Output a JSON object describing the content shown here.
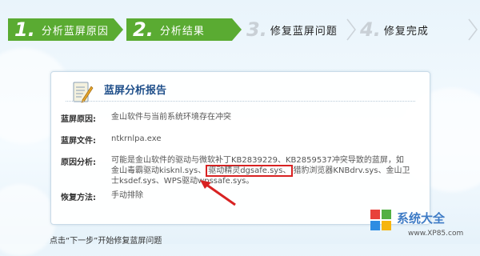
{
  "steps": [
    {
      "num": "1.",
      "label": "分析蓝屏原因",
      "state": "done"
    },
    {
      "num": "2.",
      "label": "分析结果",
      "state": "done"
    },
    {
      "num": "3.",
      "label": "修复蓝屏问题",
      "state": "todo"
    },
    {
      "num": "4.",
      "label": "修复完成",
      "state": "todo"
    }
  ],
  "report": {
    "title": "蓝屏分析报告",
    "cause_label": "蓝屏原因:",
    "cause_value": "金山软件与当前系统环境存在冲突",
    "file_label": "蓝屏文件:",
    "file_value": "ntkrnlpa.exe",
    "analysis_label": "原因分析:",
    "analysis_pre": "可能是金山软件的驱动与微软补丁KB2839229、KB2859537冲突导致的蓝屏，如金山毒霸驱动kisknl.sys、",
    "analysis_highlight": "驱动精灵dgsafe.sys、",
    "analysis_post": "猎豹浏览器KNBdrv.sys、金山卫士ksdef.sys、WPS驱动wpssafe.sys。",
    "fix_label": "恢复方法:",
    "fix_value": "手动排除"
  },
  "bottom_hint": "点击“下一步”开始修复蓝屏问题",
  "watermark": {
    "text": "系统大全",
    "url": "www.XP85.com"
  },
  "colors": {
    "step_done": "#5aab32",
    "highlight_border": "#d82222",
    "title": "#1f4f8a"
  }
}
